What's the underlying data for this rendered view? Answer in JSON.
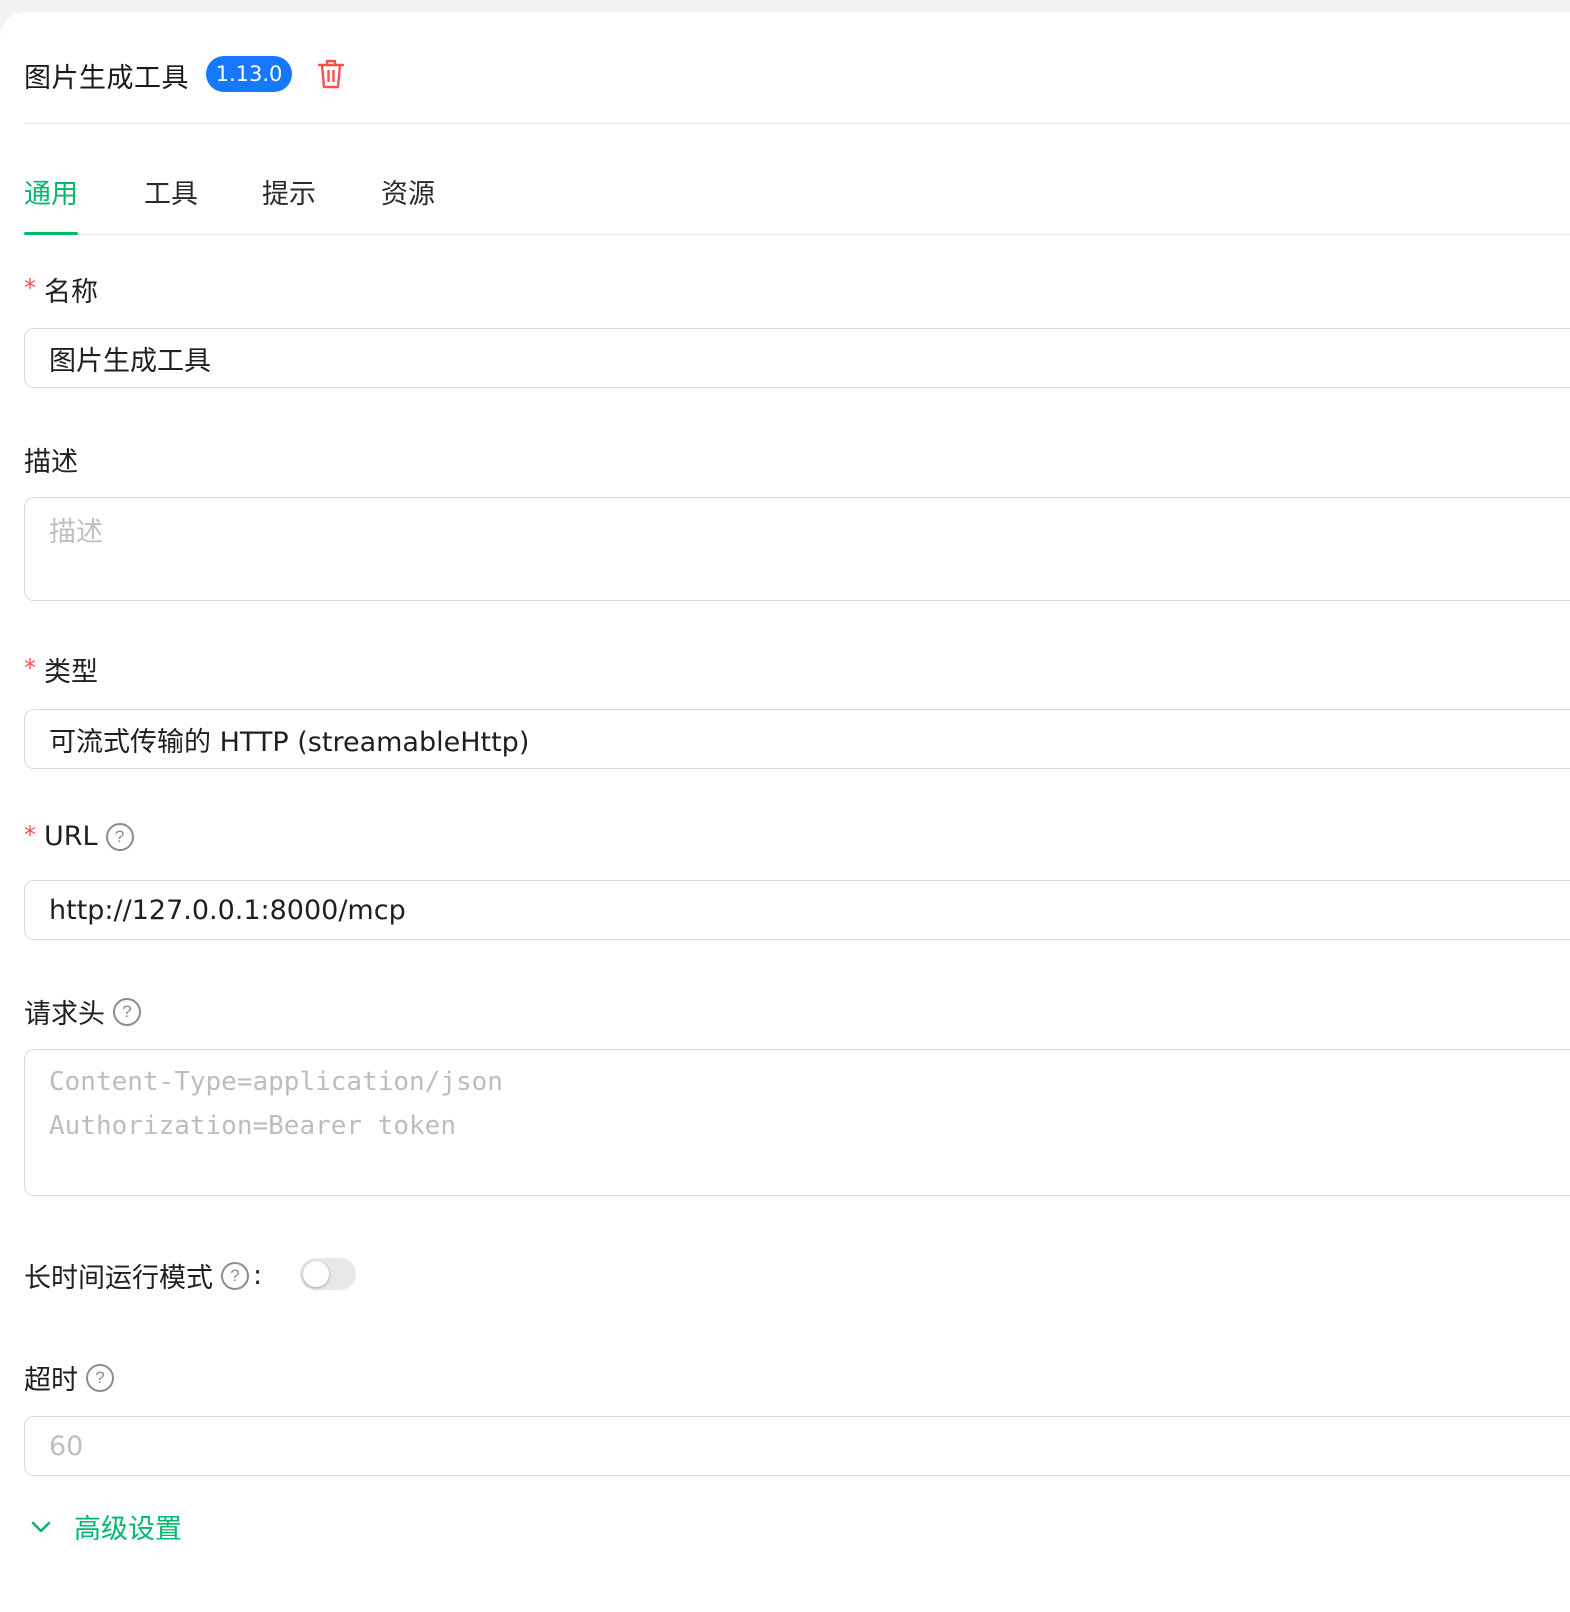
{
  "header": {
    "title": "图片生成工具",
    "version": "1.13.0"
  },
  "tabs": [
    {
      "label": "通用",
      "active": true
    },
    {
      "label": "工具",
      "active": false
    },
    {
      "label": "提示",
      "active": false
    },
    {
      "label": "资源",
      "active": false
    }
  ],
  "form": {
    "name": {
      "label": "名称",
      "required": true,
      "value": "图片生成工具"
    },
    "description": {
      "label": "描述",
      "required": false,
      "placeholder": "描述"
    },
    "type": {
      "label": "类型",
      "required": true,
      "value": "可流式传输的 HTTP (streamableHttp)"
    },
    "url": {
      "label": "URL",
      "required": true,
      "value": "http://127.0.0.1:8000/mcp"
    },
    "headers": {
      "label": "请求头",
      "placeholder_line1": "Content-Type=application/json",
      "placeholder_line2": "Authorization=Bearer token"
    },
    "long_running": {
      "label": "长时间运行模式",
      "colon": ":",
      "enabled": false
    },
    "timeout": {
      "label": "超时",
      "placeholder": "60"
    },
    "advanced": {
      "label": "高级设置"
    }
  },
  "colors": {
    "accent": "#00b96b",
    "badge": "#1677ff",
    "required": "#ff4d4f",
    "delete": "#ff4d4f"
  },
  "icons": {
    "delete": "trash-icon",
    "help": "question-circle-icon",
    "expand": "chevron-down-icon"
  }
}
